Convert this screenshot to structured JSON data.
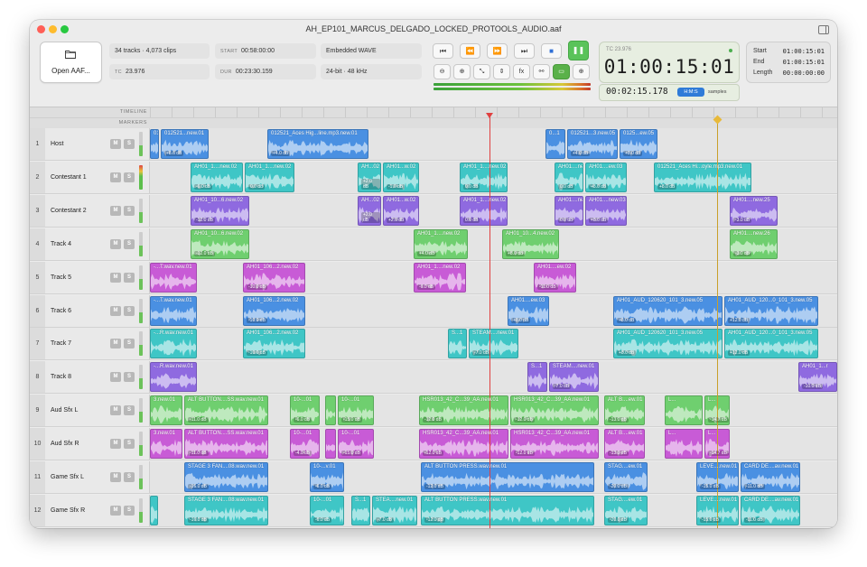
{
  "window": {
    "title": "AH_EP101_MARCUS_DELGADO_LOCKED_PROTOOLS_AUDIO.aaf",
    "colors": {
      "close": "#ff5f57",
      "minimize": "#febc2e",
      "zoom": "#28c840"
    }
  },
  "toolbar": {
    "open_label": "Open AAF...",
    "info": {
      "summary": "34 tracks · 4,073 clips",
      "tc_label": "TC",
      "tc_value": "23.976",
      "start_label": "START",
      "start_value": "00:58:00:00",
      "dur_label": "DUR",
      "dur_value": "00:23:30.159",
      "embedding": "Embedded WAVE",
      "format": "24-bit · 48 kHz"
    },
    "transport": [
      {
        "name": "go-to-start-icon",
        "glyph": "⏮"
      },
      {
        "name": "rewind-icon",
        "glyph": "⏪"
      },
      {
        "name": "fast-forward-icon",
        "glyph": "⏩"
      },
      {
        "name": "go-to-end-icon",
        "glyph": "⏭"
      },
      {
        "name": "stop-icon",
        "glyph": "■"
      },
      {
        "name": "pause-icon",
        "glyph": "❚❚"
      }
    ],
    "tools": [
      {
        "name": "zoom-out-icon",
        "glyph": "⊖"
      },
      {
        "name": "zoom-in-icon",
        "glyph": "⊕"
      },
      {
        "name": "fit-icon",
        "glyph": "⤡"
      },
      {
        "name": "vertical-zoom-icon",
        "glyph": "⇕"
      },
      {
        "name": "fx-icon",
        "glyph": "fx"
      },
      {
        "name": "link-icon",
        "glyph": "⚯"
      },
      {
        "name": "monitor-icon",
        "glyph": "▭"
      },
      {
        "name": "crosshair-icon",
        "glyph": "⊕"
      }
    ]
  },
  "timecode": {
    "fps": "TC 23.976",
    "main": "01:00:15:01",
    "secondary": "00:02:15.178",
    "mode_active": "H:M:S",
    "mode_alt": "samples",
    "status_color": "#4caf50"
  },
  "selection": {
    "start_label": "Start",
    "start": "01:00:15:01",
    "end_label": "End",
    "end": "01:00:15:01",
    "length_label": "Length",
    "length": "00:00:00:00"
  },
  "ruler": {
    "timeline_label": "TIMELINE",
    "markers_label": "MARKERS"
  },
  "palette": {
    "blue": "#4a90e2",
    "teal": "#3fc6c6",
    "purple": "#8f6ae0",
    "green": "#6fcf6f",
    "magenta": "#c85bd6",
    "green2": "#5dbb5d",
    "playhead": "#e04040",
    "marker": "#d4a52a"
  },
  "tracks": [
    {
      "num": "1",
      "name": "Host",
      "mute": "M",
      "solo": "S",
      "color": "blue",
      "clips": [
        {
          "label": "01-",
          "gain": "",
          "s": 0,
          "e": 10
        },
        {
          "label": "012521...new.01",
          "gain": "+8.6 dB",
          "s": 12,
          "e": 65
        },
        {
          "label": "012521_Aces Hig...line.mp3.new.01",
          "gain": "+4.0 dB",
          "s": 130,
          "e": 242
        },
        {
          "label": "0...1",
          "gain": "",
          "s": 438,
          "e": 460
        },
        {
          "label": "012521...3.new.05",
          "gain": "+4.0 dB",
          "s": 462,
          "e": 518
        },
        {
          "label": "0125...ew.05",
          "gain": "+8.0 dB",
          "s": 520,
          "e": 562
        }
      ]
    },
    {
      "num": "2",
      "name": "Contestant 1",
      "mute": "M",
      "solo": "S",
      "color": "teal",
      "clips": [
        {
          "label": "AH01_1....new.02",
          "gain": "-6.0 dB",
          "s": 45,
          "e": 103
        },
        {
          "label": "AH01_1....new.02",
          "gain": "0.0 dB",
          "s": 105,
          "e": 160
        },
        {
          "label": "AH...02",
          "gain": "+2.0 dB",
          "s": 230,
          "e": 256
        },
        {
          "label": "AH01...w.02",
          "gain": "-1.0 dB",
          "s": 258,
          "e": 298
        },
        {
          "label": "AH01_1....new.02",
          "gain": "0.0 dB",
          "s": 343,
          "e": 396
        },
        {
          "label": "AH01....new.03",
          "gain": "0.0 dB",
          "s": 448,
          "e": 480
        },
        {
          "label": "AH01....ew.03",
          "gain": "+8.0 dB",
          "s": 482,
          "e": 528
        },
        {
          "label": "012521_Aces Hi...oyle.mp3.new.01",
          "gain": "+8.0 dB",
          "s": 558,
          "e": 666
        }
      ]
    },
    {
      "num": "3",
      "name": "Contestant 2",
      "mute": "M",
      "solo": "S",
      "color": "purple",
      "clips": [
        {
          "label": "AH01_10...6.new.02",
          "gain": "-12.0 dB",
          "s": 45,
          "e": 110
        },
        {
          "label": "AH...02",
          "gain": "+2.0 dB",
          "s": 230,
          "e": 256
        },
        {
          "label": "AH01...w.02",
          "gain": "+2.0 dB",
          "s": 258,
          "e": 298
        },
        {
          "label": "AH01_1....new.02",
          "gain": "0.0 dB",
          "s": 343,
          "e": 396
        },
        {
          "label": "AH01....new.03",
          "gain": "0.0 dB",
          "s": 448,
          "e": 480
        },
        {
          "label": "AH01....new.03",
          "gain": "+8.0 dB",
          "s": 482,
          "e": 528
        },
        {
          "label": "AH01....new.25",
          "gain": "-3.0 dB",
          "s": 642,
          "e": 695
        }
      ]
    },
    {
      "num": "4",
      "name": "Track 4",
      "mute": "M",
      "solo": "S",
      "color": "green",
      "clips": [
        {
          "label": "AH01_10...6.new.02",
          "gain": "-12.0 dB",
          "s": 45,
          "e": 110
        },
        {
          "label": "AH01_1....new.02",
          "gain": "+4.0 dB",
          "s": 292,
          "e": 352
        },
        {
          "label": "AH01_10...4.new.02",
          "gain": "+8.0 dB",
          "s": 390,
          "e": 453
        },
        {
          "label": "AH01....new.26",
          "gain": "-3.0 dB",
          "s": 642,
          "e": 695
        }
      ]
    },
    {
      "num": "5",
      "name": "Track 5",
      "mute": "M",
      "solo": "S",
      "color": "magenta",
      "clips": [
        {
          "label": "-...T.wav.new.01",
          "gain": "",
          "s": 0,
          "e": 52
        },
        {
          "label": "AH01_106...2.new.02",
          "gain": "-10.0 dB",
          "s": 103,
          "e": 172
        },
        {
          "label": "AH01_1....new.02",
          "gain": "-6.0 dB",
          "s": 292,
          "e": 350
        },
        {
          "label": "AH01....ew.02",
          "gain": "-11.0 dB",
          "s": 425,
          "e": 472
        }
      ]
    },
    {
      "num": "6",
      "name": "Track 6",
      "mute": "M",
      "solo": "S",
      "color": "blue",
      "clips": [
        {
          "label": "-...T.wav.new.01",
          "gain": "",
          "s": 0,
          "e": 52
        },
        {
          "label": "AH01_106...2.new.02",
          "gain": "-10.0 dB",
          "s": 103,
          "e": 172
        },
        {
          "label": "AH01....ew.03",
          "gain": "+8.0 dB",
          "s": 396,
          "e": 442
        },
        {
          "label": "AH01_AUD_120620_101_3.new.05",
          "gain": "+8.0 dB",
          "s": 513,
          "e": 634
        },
        {
          "label": "AH01_AUD_120...0_101_3.new.05",
          "gain": "+12.0 dB",
          "s": 636,
          "e": 740
        }
      ]
    },
    {
      "num": "7",
      "name": "Track 7",
      "mute": "M",
      "solo": "S",
      "color": "teal",
      "clips": [
        {
          "label": "-...R.wav.new.01",
          "gain": "",
          "s": 0,
          "e": 52
        },
        {
          "label": "AH01_106...2.new.02",
          "gain": "-10.0 dB",
          "s": 103,
          "e": 172
        },
        {
          "label": "S...1",
          "gain": "",
          "s": 330,
          "e": 351
        },
        {
          "label": "STEAM....new.01",
          "gain": "-7.0 dB",
          "s": 353,
          "e": 408
        },
        {
          "label": "AH01_AUD_120620_101_3.new.05",
          "gain": "+8.0 dB",
          "s": 513,
          "e": 634
        },
        {
          "label": "AH01_AUD_120...0_101_3.new.05",
          "gain": "+12.0 dB",
          "s": 636,
          "e": 740
        }
      ]
    },
    {
      "num": "8",
      "name": "Track 8",
      "mute": "M",
      "solo": "S",
      "color": "purple",
      "clips": [
        {
          "label": "-...R.wav.new.01",
          "gain": "",
          "s": 0,
          "e": 52
        },
        {
          "label": "S...1",
          "gain": "",
          "s": 418,
          "e": 440
        },
        {
          "label": "STEAM....new.01",
          "gain": "-7.0 dB",
          "s": 442,
          "e": 497
        },
        {
          "label": "AH01_1...r",
          "gain": "-10.0 dB",
          "s": 718,
          "e": 761
        }
      ]
    },
    {
      "num": "9",
      "name": "Aud Sfx L",
      "mute": "M",
      "solo": "S",
      "color": "green",
      "clips": [
        {
          "label": "3.new.01",
          "gain": "",
          "s": 0,
          "e": 36
        },
        {
          "label": "ALT BUTTON....SS.wav.new.01",
          "gain": "-11.0 dB",
          "s": 38,
          "e": 131
        },
        {
          "label": "10-...01",
          "gain": "-6.0 dB",
          "s": 155,
          "e": 188
        },
        {
          "label": "",
          "gain": "",
          "s": 194,
          "e": 206
        },
        {
          "label": "10-...01",
          "gain": "-15.0 dB",
          "s": 208,
          "e": 248
        },
        {
          "label": "HSR013_42_C...39_AA.new.01",
          "gain": "-12.0 dB",
          "s": 298,
          "e": 397
        },
        {
          "label": "HSR013_42_C...39_AA.new.01",
          "gain": "-12.0 dB",
          "s": 399,
          "e": 497
        },
        {
          "label": "ALT B....ew.01",
          "gain": "-13.0 dB",
          "s": 503,
          "e": 548
        },
        {
          "label": "L...",
          "gain": "",
          "s": 570,
          "e": 612
        },
        {
          "label": "L...",
          "gain": "-14.7 dB",
          "s": 614,
          "e": 642
        }
      ]
    },
    {
      "num": "10",
      "name": "Aud Sfx R",
      "mute": "M",
      "solo": "S",
      "color": "magenta",
      "clips": [
        {
          "label": "3.new.01",
          "gain": "",
          "s": 0,
          "e": 36
        },
        {
          "label": "ALT BUTTON....SS.wav.new.01",
          "gain": "-11.0 dB",
          "s": 38,
          "e": 131
        },
        {
          "label": "10-...01",
          "gain": "-4.0 dB",
          "s": 155,
          "e": 188
        },
        {
          "label": "",
          "gain": "",
          "s": 194,
          "e": 206
        },
        {
          "label": "10-...01",
          "gain": "-15.0 dB",
          "s": 208,
          "e": 248
        },
        {
          "label": "HSR013_42_C...39_AA.new.01",
          "gain": "-12.0 dB",
          "s": 298,
          "e": 397
        },
        {
          "label": "HSR013_42_C...39_AA.new.01",
          "gain": "-12.0 dB",
          "s": 399,
          "e": 497
        },
        {
          "label": "ALT B....ew.01",
          "gain": "-13.0 dB",
          "s": 503,
          "e": 548
        },
        {
          "label": "L...",
          "gain": "",
          "s": 570,
          "e": 612
        },
        {
          "label": "L...",
          "gain": "-14.7 dB",
          "s": 614,
          "e": 642
        }
      ]
    },
    {
      "num": "11",
      "name": "Game Sfx L",
      "mute": "M",
      "solo": "S",
      "color": "blue",
      "clips": [
        {
          "label": "STAGE 3 FAN....08.wav.new.01",
          "gain": "-16.0 dB",
          "s": 38,
          "e": 131
        },
        {
          "label": "10-...v.01",
          "gain": "-6.0 dB",
          "s": 177,
          "e": 215
        },
        {
          "label": "ALT BUTTON PRESS.wav.new.01",
          "gain": "-12.0 dB",
          "s": 300,
          "e": 492
        },
        {
          "label": "STAG....ew.01",
          "gain": "-20.0 dB",
          "s": 503,
          "e": 551
        },
        {
          "label": "LEVE....new.01",
          "gain": "-15.0 dB",
          "s": 605,
          "e": 652
        },
        {
          "label": "CARD DE....av.new.01",
          "gain": "-11.0 dB",
          "s": 654,
          "e": 720
        }
      ]
    },
    {
      "num": "12",
      "name": "Game Sfx R",
      "mute": "M",
      "solo": "S",
      "color": "teal",
      "clips": [
        {
          "label": "",
          "gain": "",
          "s": 0,
          "e": 9
        },
        {
          "label": "STAGE 3 FAN....08.wav.new.01",
          "gain": "-16.0 dB",
          "s": 38,
          "e": 131
        },
        {
          "label": "10-...01",
          "gain": "-6.0 dB",
          "s": 177,
          "e": 215
        },
        {
          "label": "S...1",
          "gain": "",
          "s": 223,
          "e": 244
        },
        {
          "label": "STEA....new.01",
          "gain": "-7.0 dB",
          "s": 246,
          "e": 296
        },
        {
          "label": "ALT BUTTON PRESS.wav.new.01",
          "gain": "-12.0 dB",
          "s": 300,
          "e": 492
        },
        {
          "label": "STAG....ew.01",
          "gain": "-20.0 dB",
          "s": 503,
          "e": 551
        },
        {
          "label": "LEVE....new.01",
          "gain": "-15.0 dB",
          "s": 605,
          "e": 652
        },
        {
          "label": "CARD DE....av.new.01",
          "gain": "-11.0 dB",
          "s": 654,
          "e": 720
        }
      ]
    }
  ]
}
